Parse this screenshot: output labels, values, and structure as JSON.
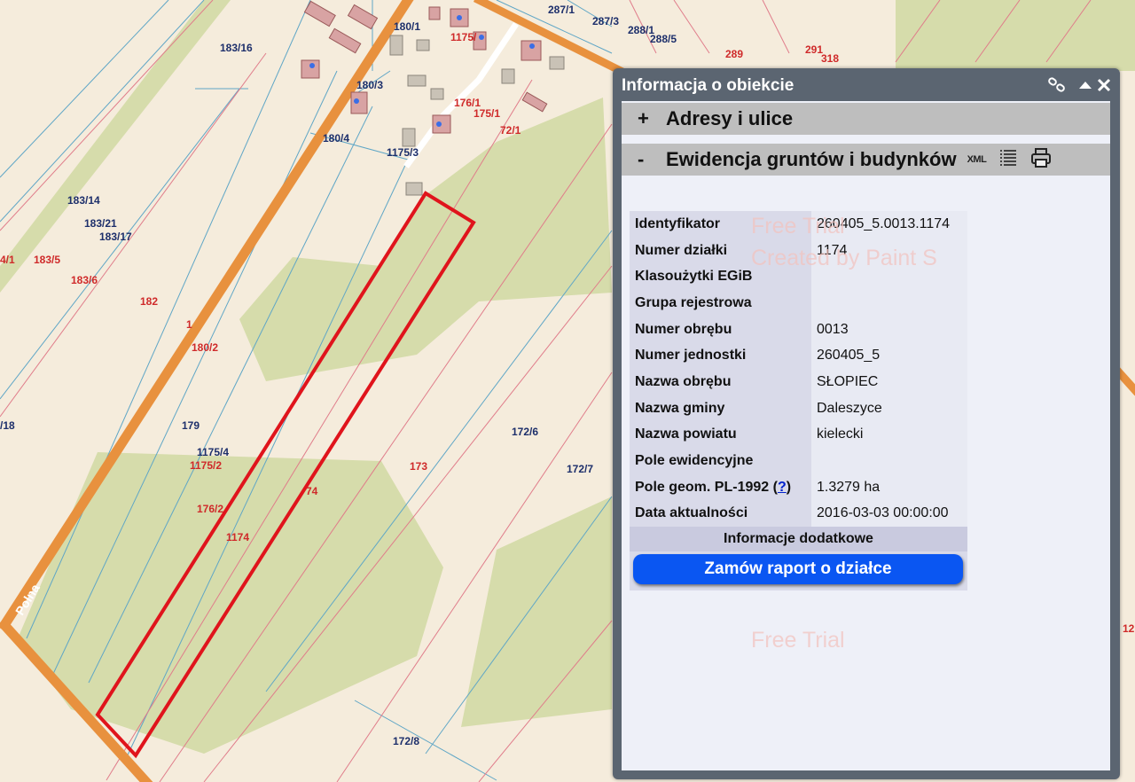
{
  "map": {
    "road_name": "Polna",
    "labels_blue": [
      "287/1",
      "287/3",
      "288/1",
      "288/5",
      "180/1",
      "183/16",
      "180/3",
      "180/4",
      "1175/3",
      "183/14",
      "183/21",
      "183/17",
      "179",
      "1175/4",
      "172/6",
      "172/7",
      "172/8",
      "/18"
    ],
    "labels_red": [
      "1175/",
      "289",
      "291",
      "318",
      "176/1",
      "175/1",
      "72/1",
      "4/1",
      "183/5",
      "183/6",
      "182",
      "1",
      "180/2",
      "1175/2",
      "176/2",
      "1174",
      "173",
      "74",
      "12"
    ]
  },
  "panel": {
    "title": "Informacja o obiekcie",
    "icons": {
      "link": "link-icon",
      "collapse": "collapse-up-icon",
      "close": "close-icon"
    },
    "sections": {
      "addresses": {
        "sign": "+",
        "label": "Adresy i ulice"
      },
      "registry": {
        "sign": "-",
        "label": "Ewidencja gruntów i budynków",
        "xml_label": "XML"
      }
    },
    "rows": [
      {
        "key": "Identyfikator",
        "value": "260405_5.0013.1174"
      },
      {
        "key": "Numer działki",
        "value": "1174"
      },
      {
        "key": "Klasoużytki EGiB",
        "value": ""
      },
      {
        "key": "Grupa rejestrowa",
        "value": ""
      },
      {
        "key": "Numer obrębu",
        "value": "0013"
      },
      {
        "key": "Numer jednostki",
        "value": "260405_5"
      },
      {
        "key": "Nazwa obrębu",
        "value": "SŁOPIEC"
      },
      {
        "key": "Nazwa gminy",
        "value": "Daleszyce"
      },
      {
        "key": "Nazwa powiatu",
        "value": "kielecki"
      },
      {
        "key": "Pole ewidencyjne",
        "value": ""
      },
      {
        "key": "Pole geom. PL-1992 (",
        "help": "?",
        "key_suffix": ")",
        "value": "1.3279 ha"
      },
      {
        "key": "Data aktualności",
        "value": "2016-03-03 00:00:00"
      }
    ],
    "extra_info": "Informacje dodatkowe",
    "report_button": "Zamów raport o działce"
  },
  "watermark": {
    "line1": "Free Trial",
    "line2": "Created by Paint S",
    "line3": "Free Trial"
  }
}
